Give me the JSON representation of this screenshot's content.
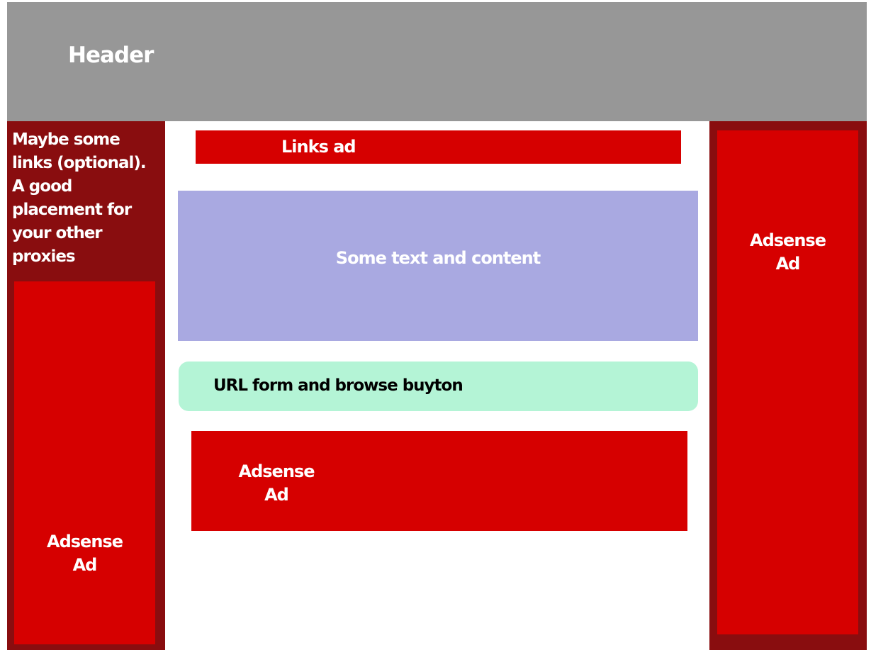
{
  "colors": {
    "header": "#979797",
    "dark_red": "#890d0f",
    "red": "#d60000",
    "content": "#a9a9e1",
    "url_form": "#b4f4d6",
    "text_light": "#ffffff",
    "text_dark": "#000000"
  },
  "header": {
    "title": "Header"
  },
  "left_column": {
    "links_text": "Maybe some\nlinks (optional).\nA good\nplacement for\nyour other\nproxies",
    "ad_text": "Adsense\nAd"
  },
  "right_column": {
    "ad_text": "Adsense\nAd"
  },
  "main": {
    "links_ad": "Links ad",
    "content": "Some text and content",
    "url_form": "URL form and browse buyton",
    "ad_text": "Adsense\nAd"
  }
}
